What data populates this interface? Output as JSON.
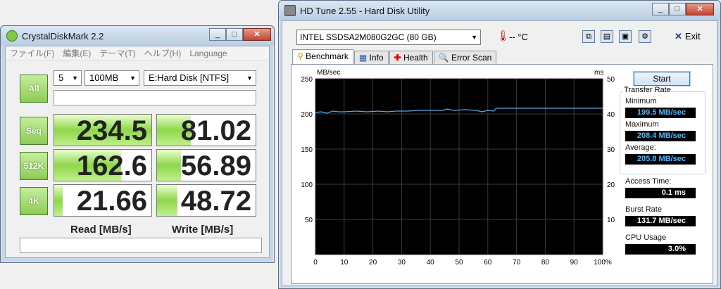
{
  "cdm": {
    "title": "CrystalDiskMark 2.2",
    "menu": [
      "ファイル(F)",
      "編集(E)",
      "テーマ(T)",
      "ヘルプ(H)",
      "Language"
    ],
    "all_label": "All",
    "count": "5",
    "size": "100MB",
    "drive": "E:Hard Disk [NTFS]",
    "rows": [
      {
        "label": "Seq",
        "read": "234.5",
        "write": "81.02",
        "read_fill": 1.0,
        "write_fill": 0.34
      },
      {
        "label": "512K",
        "read": "162.6",
        "write": "56.89",
        "read_fill": 0.69,
        "write_fill": 0.24
      },
      {
        "label": "4K",
        "read": "21.66",
        "write": "48.72",
        "read_fill": 0.09,
        "write_fill": 0.21
      }
    ],
    "read_header": "Read [MB/s]",
    "write_header": "Write [MB/s]"
  },
  "hdt": {
    "title": "HD Tune 2.55 - Hard Disk Utility",
    "drive": "INTEL SSDSA2M080G2GC (80 GB)",
    "temp": "-- °C",
    "exit": "Exit",
    "tabs": [
      "Benchmark",
      "Info",
      "Health",
      "Error Scan"
    ],
    "start": "Start",
    "transfer_rate_title": "Transfer Rate",
    "min_label": "Minimum",
    "min_value": "199.5 MB/sec",
    "max_label": "Maximum",
    "max_value": "208.4 MB/sec",
    "avg_label": "Average:",
    "avg_value": "205.8 MB/sec",
    "access_label": "Access Time:",
    "access_value": "0.1 ms",
    "burst_label": "Burst Rate",
    "burst_value": "131.7 MB/sec",
    "cpu_label": "CPU Usage",
    "cpu_value": "3.0%"
  },
  "chart_data": {
    "type": "line",
    "ylabel_left": "MB/sec",
    "ylabel_right": "ms",
    "ylim_left": [
      0,
      250
    ],
    "ylim_right": [
      0,
      50
    ],
    "yticks_left": [
      "250",
      "200",
      "150",
      "100",
      "50"
    ],
    "yticks_right": [
      "50",
      "40",
      "30",
      "20",
      "10"
    ],
    "xticks": [
      "0",
      "10",
      "20",
      "30",
      "40",
      "50",
      "60",
      "70",
      "80",
      "90",
      "100%"
    ],
    "grid": true,
    "series": [
      {
        "color": "#5aa8e8",
        "x": [
          0,
          2,
          4,
          6,
          8,
          10,
          14,
          18,
          22,
          25,
          28,
          32,
          36,
          40,
          44,
          46,
          48,
          52,
          56,
          58,
          60,
          62,
          63,
          70,
          80,
          90,
          100
        ],
        "y": [
          202,
          203,
          201,
          204,
          203,
          203,
          204,
          203,
          204,
          203,
          204,
          204,
          205,
          205,
          205,
          207,
          205,
          206,
          205,
          203,
          205,
          204,
          208,
          208,
          208,
          208,
          208
        ]
      }
    ]
  }
}
